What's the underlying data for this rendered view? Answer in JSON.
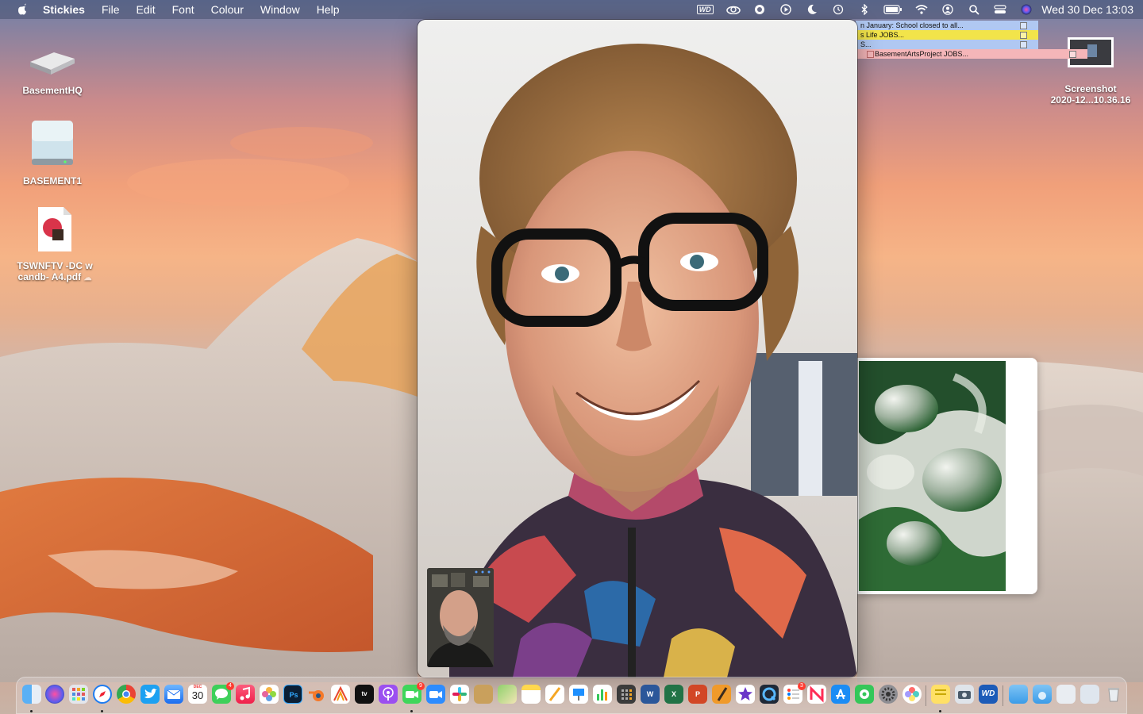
{
  "menubar": {
    "app_name": "Stickies",
    "menus": [
      "File",
      "Edit",
      "Font",
      "Colour",
      "Window",
      "Help"
    ],
    "status_icons": [
      "wd-icon",
      "creative-cloud-icon",
      "sync-icon",
      "play-icon",
      "do-not-disturb-icon",
      "time-machine-icon",
      "bluetooth-icon",
      "battery-icon",
      "wifi-icon",
      "user-icon",
      "search-icon",
      "control-center-icon",
      "siri-icon"
    ],
    "wd_label": "WD",
    "clock": "Wed 30 Dec  13:03"
  },
  "desktop": {
    "icons": [
      {
        "label": "BasementHQ",
        "kind": "external-drive-icon"
      },
      {
        "label": "BASEMENT1",
        "kind": "disk-icon"
      },
      {
        "label_line1": "TSWNFTV -DC w",
        "label_line2": "candb- A4.pdf",
        "kind": "pdf-icon"
      },
      {
        "label_line1": "Screenshot",
        "label_line2": "2020-12...10.36.16",
        "kind": "screenshot-icon"
      }
    ]
  },
  "stickies": [
    {
      "text": "n January: School closed to all...",
      "color": "#b0c8f2"
    },
    {
      "text": "s Life JOBS...",
      "color": "#f2e44a"
    },
    {
      "text": "S...",
      "color": "#b0c8f2"
    },
    {
      "text": "BasementArtsProject JOBS...",
      "color": "#f5b6b9"
    }
  ],
  "dock": {
    "calendar_day": "30",
    "calendar_month": "DEC",
    "messages_badge": "4",
    "facetime_badge": "9",
    "reminders_badge": "3",
    "ps_label": "Ps",
    "word_label": "W",
    "excel_label": "X",
    "ppt_label": "P",
    "wd_label": "WD",
    "apps": [
      "finder",
      "siri",
      "launchpad",
      "safari",
      "chrome",
      "twitter",
      "mail",
      "calendar",
      "messages",
      "music",
      "photos",
      "photoshop",
      "blender",
      "affinity",
      "apple-tv",
      "podcasts",
      "facetime",
      "zoom",
      "slack",
      "keychain",
      "maps",
      "notes",
      "textedit",
      "keynote",
      "numbers",
      "calculator",
      "word",
      "excel",
      "powerpoint",
      "garageband",
      "imovie",
      "quicktime",
      "reminders",
      "news",
      "app-store",
      "find-my",
      "system-preferences",
      "color-picker",
      "stickies",
      "screenshot",
      "wd-discovery",
      "folder",
      "downloads",
      "preview",
      "files",
      "trash"
    ]
  }
}
